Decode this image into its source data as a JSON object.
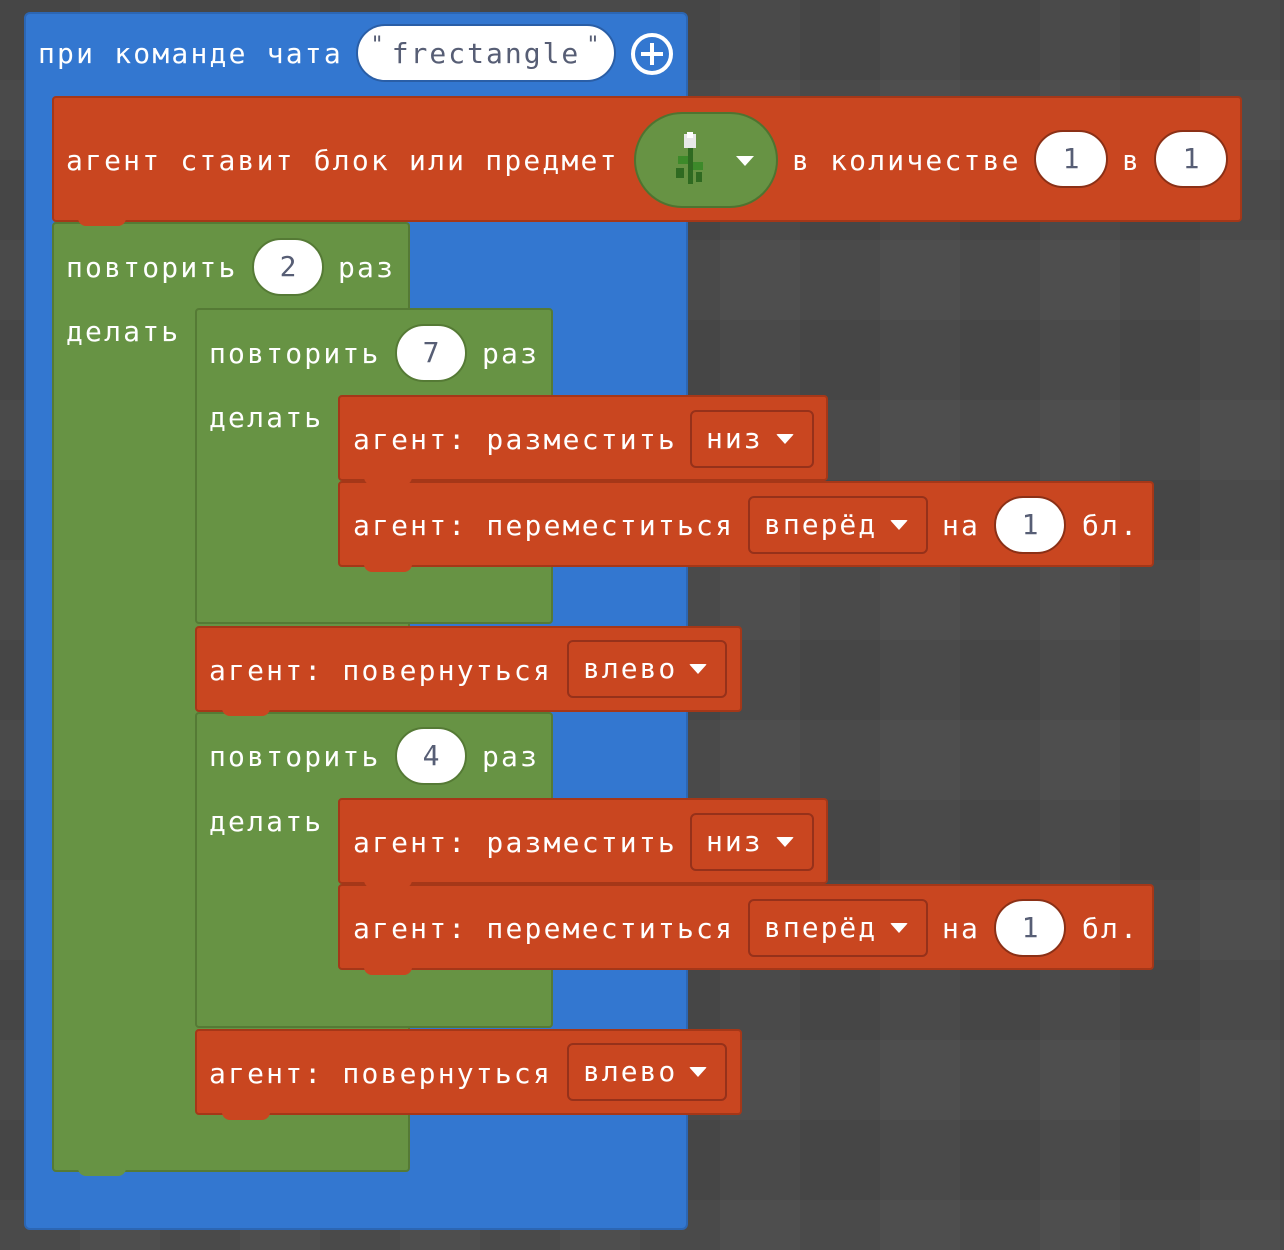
{
  "event": {
    "label": "при команде чата",
    "command": "frectangle",
    "quote_open": "\"",
    "quote_close": "\"",
    "add_icon": "plus-circle-icon"
  },
  "place_block": {
    "label": "агент ставит блок или предмет",
    "item_icon": "flower-icon",
    "count_label": "в количестве",
    "count": "1",
    "slot_label": "в",
    "slot": "1"
  },
  "outer_repeat": {
    "label": "повторить",
    "times": "2",
    "suffix": "раз",
    "do_label": "делать"
  },
  "repeat_a": {
    "label": "повторить",
    "times": "7",
    "suffix": "раз",
    "do_label": "делать"
  },
  "repeat_b": {
    "label": "повторить",
    "times": "4",
    "suffix": "раз",
    "do_label": "делать"
  },
  "place_cmd": {
    "label": "агент: разместить",
    "direction": "низ"
  },
  "move_cmd": {
    "label": "агент: переместиться",
    "direction": "вперёд",
    "on_label": "на",
    "distance": "1",
    "unit": "бл."
  },
  "turn_cmd": {
    "label": "агент: повернуться",
    "direction": "влево"
  },
  "colors": {
    "event": "#3377d0",
    "loop": "#679344",
    "agent": "#c94620",
    "background": "#4a4a4a"
  }
}
